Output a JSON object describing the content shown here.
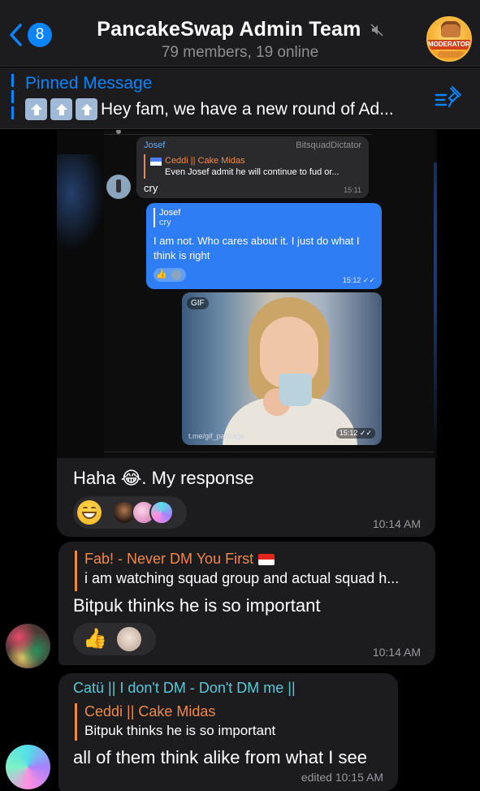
{
  "header": {
    "back_count": "8",
    "title": "PancakeSwap Admin Team",
    "subtitle": "79 members, 19 online",
    "avatar_label": "MODERATORS"
  },
  "pinned": {
    "title": "Pinned Message",
    "text": "Hey fam, we have a new round of Ad..."
  },
  "screenshot": {
    "msg1": {
      "sender": "Josef",
      "right_label": "BitsquadDictator",
      "quote_name": "Ceddi || Cake Midas",
      "quote_text": "Even Josef admit he will continue to fud or...",
      "text": "cry",
      "time": "15:11"
    },
    "msg2": {
      "quote_name": "Josef",
      "quote_text": "cry",
      "text": "I am not. Who cares about it. I just do what I think is right",
      "time": "15:12"
    },
    "gif": {
      "label": "GIF",
      "source": "t.me/gif_package",
      "time": "15:12"
    }
  },
  "messages": [
    {
      "text": "Haha 😂. My response",
      "time": "10:14 AM"
    },
    {
      "quote_name": "Fab! - Never DM You First",
      "quote_text": "i am watching squad group and actual squad h...",
      "text": "Bitpuk thinks he is so important",
      "time": "10:14 AM"
    },
    {
      "sender": "Catü || I don't DM - Don't DM me ||",
      "quote_name": "Ceddi || Cake Midas",
      "quote_text": "Bitpuk thinks he is so important",
      "text": "all of them think alike from what I see",
      "time": "edited 10:15 AM"
    }
  ],
  "colors": {
    "accent": "#0a84ff",
    "bubble": "#1c1c1e",
    "quote_name": "#f0884a",
    "sender_teal": "#5ac8d8"
  }
}
